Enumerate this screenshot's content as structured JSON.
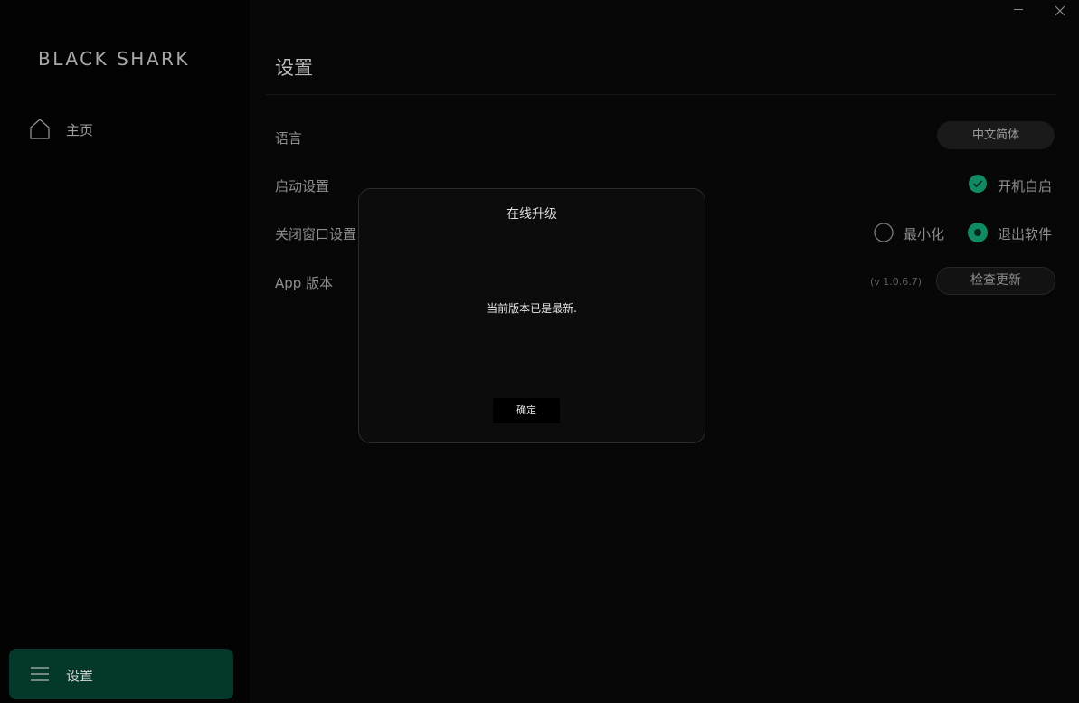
{
  "brand": {
    "logo_text": "BLACK SHARK"
  },
  "nav": {
    "home_label": "主页",
    "settings_label": "设置"
  },
  "page": {
    "title": "设置"
  },
  "settings": {
    "language": {
      "label": "语言",
      "value": "中文简体"
    },
    "startup": {
      "label": "启动设置",
      "option": "开机自启",
      "checked": true
    },
    "close_window": {
      "label": "关闭窗口设置",
      "options": [
        "最小化",
        "退出软件"
      ],
      "selected": "退出软件"
    },
    "app_version": {
      "label": "App 版本",
      "version": "(v 1.0.6.7)",
      "check_button": "检查更新"
    }
  },
  "dialog": {
    "title": "在线升级",
    "message": "当前版本已是最新.",
    "confirm_label": "确定"
  },
  "colors": {
    "accent": "#0f8a63",
    "sidebar_active": "#03382a"
  }
}
